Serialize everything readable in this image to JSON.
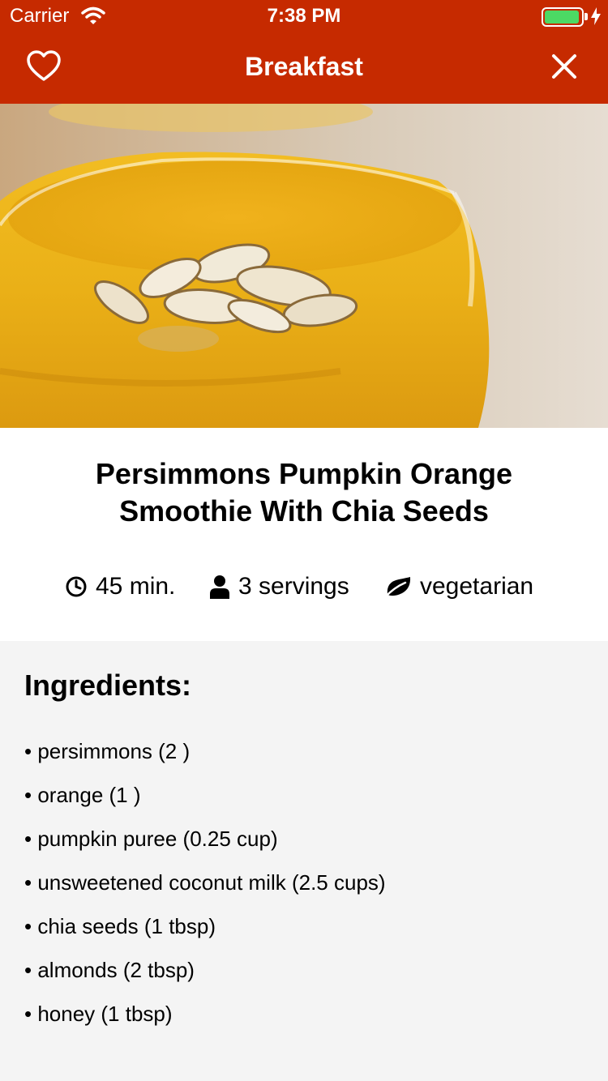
{
  "status_bar": {
    "carrier": "Carrier",
    "time": "7:38 PM",
    "battery_level": 0.95
  },
  "nav": {
    "title": "Breakfast",
    "favorite_icon": "heart-outline-icon",
    "close_icon": "close-icon"
  },
  "colors": {
    "nav_background": "#c62a00",
    "content_background": "#f4f4f4",
    "battery": "#4cd964"
  },
  "recipe": {
    "title": "Persimmons Pumpkin Orange Smoothie With Chia Seeds",
    "meta": {
      "time": "45 min.",
      "servings": "3 servings",
      "diet": "vegetarian"
    }
  },
  "ingredients": {
    "heading": "Ingredients:",
    "items": [
      "persimmons (2 )",
      "orange (1 )",
      "pumpkin puree (0.25 cup)",
      "unsweetened coconut milk (2.5 cups)",
      "chia seeds (1 tbsp)",
      "almonds (2 tbsp)",
      "honey (1 tbsp)"
    ]
  }
}
